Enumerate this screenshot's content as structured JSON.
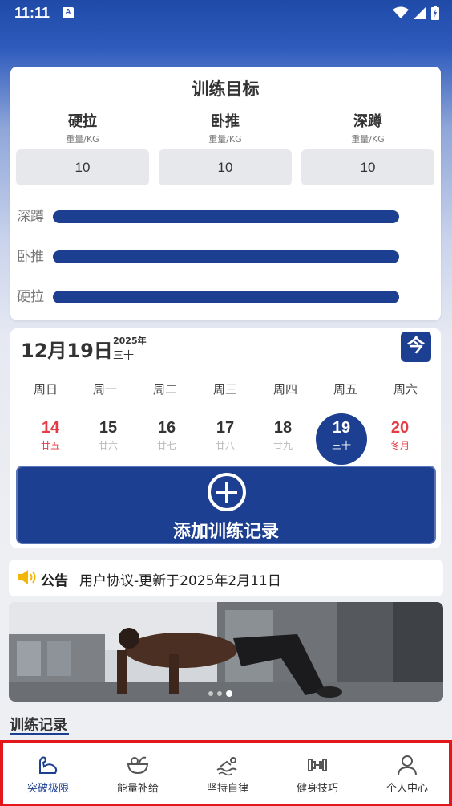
{
  "status": {
    "time": "11:11",
    "a_badge": "A"
  },
  "goal": {
    "title": "训练目标",
    "lifts": [
      {
        "name": "硬拉",
        "unit": "重量/KG",
        "value": "10"
      },
      {
        "name": "卧推",
        "unit": "重量/KG",
        "value": "10"
      },
      {
        "name": "深蹲",
        "unit": "重量/KG",
        "value": "10"
      }
    ],
    "bars": [
      {
        "label": "深蹲",
        "level": 1.0
      },
      {
        "label": "卧推",
        "level": 1.0
      },
      {
        "label": "硬拉",
        "level": 1.0
      }
    ],
    "bar_color": "#1d3f91"
  },
  "calendar": {
    "date": "12月19日",
    "year": "2025年",
    "lunar": "三十",
    "today_label": "今",
    "weekdays": [
      "周日",
      "周一",
      "周二",
      "周三",
      "周四",
      "周五",
      "周六"
    ],
    "days": [
      {
        "num": "14",
        "lunar": "廿五",
        "style": "red"
      },
      {
        "num": "15",
        "lunar": "廿六",
        "style": "normal"
      },
      {
        "num": "16",
        "lunar": "廿七",
        "style": "normal"
      },
      {
        "num": "17",
        "lunar": "廿八",
        "style": "normal"
      },
      {
        "num": "18",
        "lunar": "廿九",
        "style": "normal"
      },
      {
        "num": "19",
        "lunar": "三十",
        "style": "selected"
      },
      {
        "num": "20",
        "lunar": "冬月",
        "style": "red"
      }
    ],
    "add_label": "添加训练记录"
  },
  "notice": {
    "tag": "公告",
    "text": "用户协议-更新于2025年2月11日"
  },
  "banner": {
    "dots": 3,
    "active_dot": 3
  },
  "records": {
    "title": "训练记录"
  },
  "tabs": [
    {
      "label": "突破极限",
      "icon": "arm-icon",
      "active": true
    },
    {
      "label": "能量补给",
      "icon": "food-bowl-icon",
      "active": false
    },
    {
      "label": "坚持自律",
      "icon": "swimmer-icon",
      "active": false
    },
    {
      "label": "健身技巧",
      "icon": "dumbbell-icon",
      "active": false
    },
    {
      "label": "个人中心",
      "icon": "person-icon",
      "active": false
    }
  ],
  "colors": {
    "primary": "#1d3f91",
    "accent_red": "#e53b44",
    "highlight_border": "#e3161c"
  }
}
